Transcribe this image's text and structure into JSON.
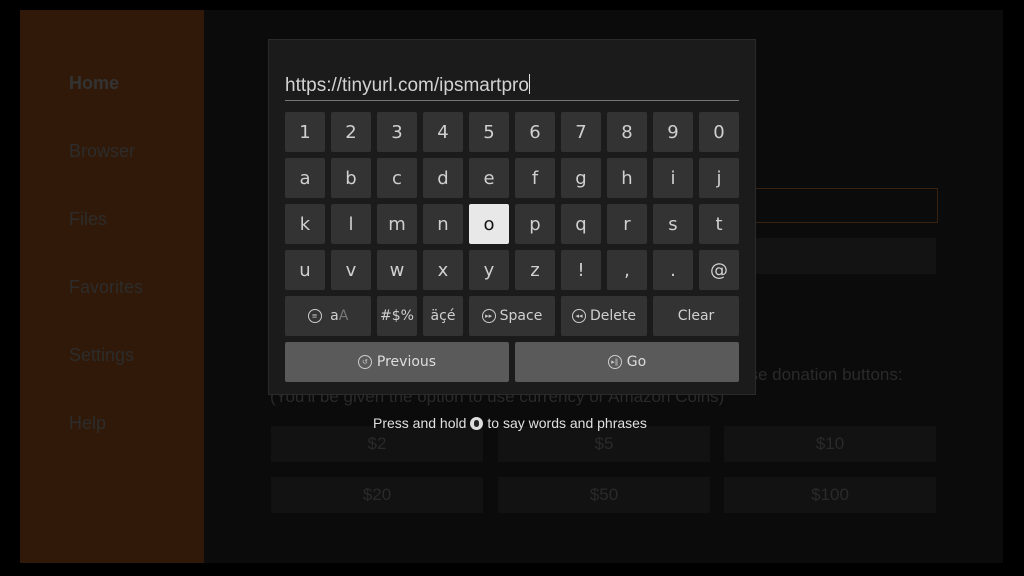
{
  "sidebar": {
    "items": [
      {
        "label": "Home",
        "active": true
      },
      {
        "label": "Browser"
      },
      {
        "label": "Files"
      },
      {
        "label": "Favorites"
      },
      {
        "label": "Settings"
      },
      {
        "label": "Help"
      }
    ]
  },
  "background": {
    "donation_text_1": "ase donation buttons:",
    "donation_text_2": "(You'll be given the option to use currency or Amazon Coins)",
    "donation_buttons": [
      "$2",
      "$5",
      "$10",
      "$20",
      "$50",
      "$100"
    ]
  },
  "keyboard": {
    "url_value": "https://tinyurl.com/ipsmartpro",
    "rows": [
      [
        "1",
        "2",
        "3",
        "4",
        "5",
        "6",
        "7",
        "8",
        "9",
        "0"
      ],
      [
        "a",
        "b",
        "c",
        "d",
        "e",
        "f",
        "g",
        "h",
        "i",
        "j"
      ],
      [
        "k",
        "l",
        "m",
        "n",
        "o",
        "p",
        "q",
        "r",
        "s",
        "t"
      ],
      [
        "u",
        "v",
        "w",
        "x",
        "y",
        "z",
        "!",
        ",",
        ".",
        "@"
      ]
    ],
    "focused_key": "o",
    "case_toggle": {
      "icon": "menu-icon",
      "lower": "a",
      "upper": "A"
    },
    "symbols_label": "#$%",
    "accents_label": "äçé",
    "space": {
      "icon": "fast-forward-icon",
      "label": "Space"
    },
    "delete": {
      "icon": "rewind-icon",
      "label": "Delete"
    },
    "clear_label": "Clear",
    "previous": {
      "icon": "back-icon",
      "label": "Previous"
    },
    "go": {
      "icon": "play-pause-icon",
      "label": "Go"
    }
  },
  "hint": {
    "before": "Press and hold",
    "icon": "microphone-icon",
    "after": "to say words and phrases"
  }
}
